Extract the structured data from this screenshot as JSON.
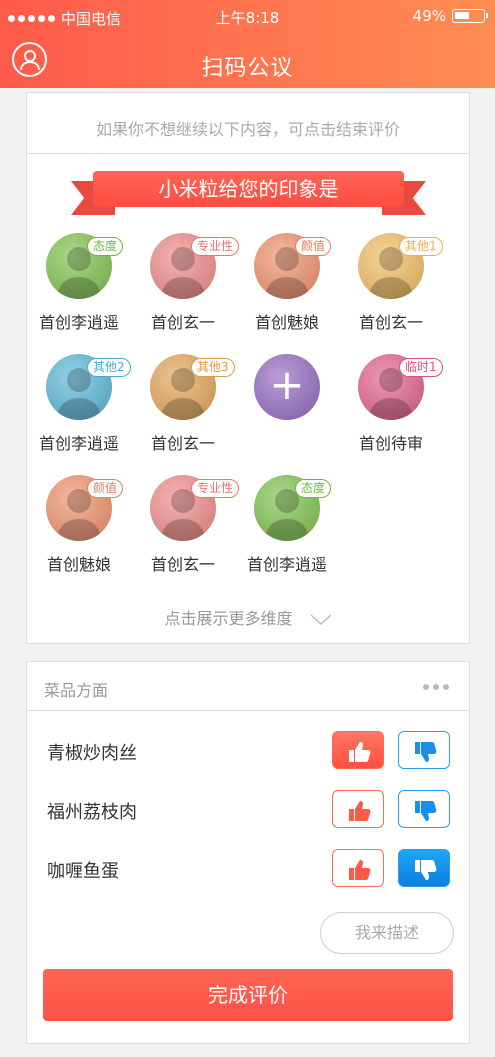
{
  "status": {
    "carrier": "中国电信",
    "time": "上午8:18",
    "battery": "49%"
  },
  "nav": {
    "title": "扫码公议"
  },
  "hint": "如果你不想继续以下内容，可点击结束评价",
  "banner": "小米粒给您的印象是",
  "impressions": [
    {
      "tag": "态度",
      "name": "首创李逍遥",
      "color": "#7ec24c",
      "tagColor": "#6db93a"
    },
    {
      "tag": "专业性",
      "name": "首创玄一",
      "color": "#f08a86",
      "tagColor": "#f0726d"
    },
    {
      "tag": "颜值",
      "name": "首创魅娘",
      "color": "#f0906a",
      "tagColor": "#e77e58"
    },
    {
      "tag": "其他1",
      "name": "首创玄一",
      "color": "#f2bd60",
      "tagColor": "#efb045"
    },
    {
      "tag": "其他2",
      "name": "首创李逍遥",
      "color": "#58b8d8",
      "tagColor": "#47aad0"
    },
    {
      "tag": "其他3",
      "name": "首创玄一",
      "color": "#e4a556",
      "tagColor": "#dd9a45"
    },
    {
      "tag": "",
      "name": "",
      "color": "#9569c1",
      "tagColor": "",
      "plus": "+"
    },
    {
      "tag": "临时1",
      "name": "首创待审",
      "color": "#e3608c",
      "tagColor": "#df4f7d"
    },
    {
      "tag": "颜值",
      "name": "首创魅娘",
      "color": "#f0906a",
      "tagColor": "#e77e58"
    },
    {
      "tag": "专业性",
      "name": "首创玄一",
      "color": "#f08a86",
      "tagColor": "#f0726d"
    },
    {
      "tag": "态度",
      "name": "首创李逍遥",
      "color": "#7ec24c",
      "tagColor": "#6db93a"
    }
  ],
  "more": "点击展示更多维度",
  "dishes": {
    "title": "菜品方面",
    "items": [
      {
        "name": "青椒炒肉丝",
        "up": true,
        "down": false
      },
      {
        "name": "福州荔枝肉",
        "up": false,
        "down": false
      },
      {
        "name": "咖喱鱼蛋",
        "up": false,
        "down": true
      }
    ],
    "describe": "我来描述",
    "submit": "完成评价"
  }
}
